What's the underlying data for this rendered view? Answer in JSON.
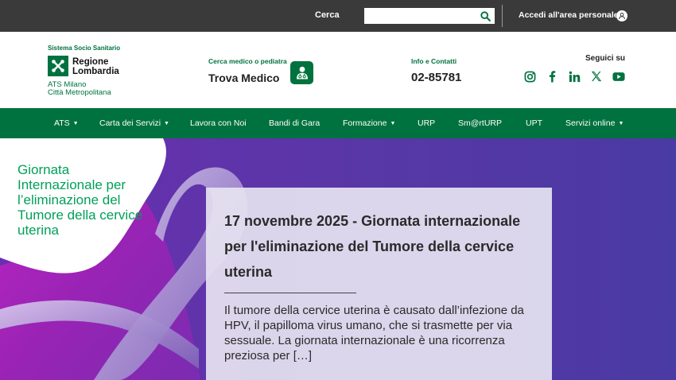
{
  "topbar": {
    "search_label": "Cerca",
    "search_value": "",
    "personal_area": "Accedi all'area personale"
  },
  "header": {
    "logo": {
      "system": "Sistema Socio Sanitario",
      "region_line1": "Regione",
      "region_line2": "Lombardia",
      "ats_line1": "ATS Milano",
      "ats_line2": "Città Metropolitana"
    },
    "doctor": {
      "small": "Cerca medico o pediatra",
      "big": "Trova Medico"
    },
    "contact": {
      "small": "Info e Contatti",
      "phone": "02-85781"
    },
    "social": {
      "label": "Seguici su",
      "icons": [
        "instagram-icon",
        "facebook-icon",
        "linkedin-icon",
        "x-icon",
        "youtube-icon"
      ]
    }
  },
  "nav": {
    "items": [
      {
        "label": "ATS",
        "dropdown": true
      },
      {
        "label": "Carta dei Servizi",
        "dropdown": true
      },
      {
        "label": "Lavora con Noi",
        "dropdown": false
      },
      {
        "label": "Bandi di Gara",
        "dropdown": false
      },
      {
        "label": "Formazione",
        "dropdown": true
      },
      {
        "label": "URP",
        "dropdown": false
      },
      {
        "label": "Sm@rtURP",
        "dropdown": false
      },
      {
        "label": "UPT",
        "dropdown": false
      },
      {
        "label": "Servizi online",
        "dropdown": true
      }
    ]
  },
  "hero": {
    "caption": "Giornata Internazionale per l’eliminazione del Tumore della cervice uterina",
    "card_title": "17 novembre 2025 - Giornata internazionale per l'eliminazione del Tumore della cervice uterina",
    "card_excerpt": "Il tumore della cervice uterina è causato dall’infezione da HPV, il papilloma virus umano, che si trasmette per via sessuale. La giornata internazionale è una ricorrenza preziosa per […]"
  },
  "colors": {
    "topbar_bg": "#3a3a3a",
    "brand_green": "#00723f",
    "hero_purple": "#5b3aa8",
    "hero_magenta": "#a21fb0",
    "caption_green": "#00a05a"
  }
}
